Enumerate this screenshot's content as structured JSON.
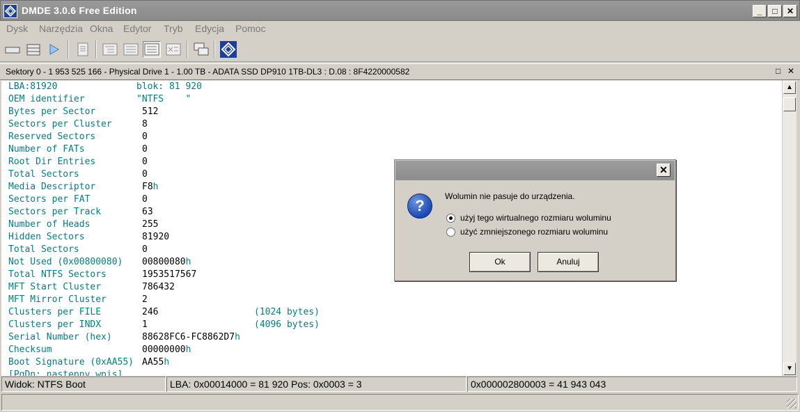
{
  "window": {
    "title": "DMDE 3.0.6 Free Edition"
  },
  "menu": [
    "Dysk",
    "Narzędzia",
    "Okna",
    "Edytor",
    "Tryb",
    "Edycja",
    "Pomoc"
  ],
  "pathbar": {
    "text": "Sektory 0 - 1 953 525 166 - Physical Drive 1 - 1.00 TB - ADATA SSD DP910 1TB-DL3 : D.08 : 8F4220000582"
  },
  "editor": {
    "header_left": "LBA:81920",
    "header_right": "blok: 81 920",
    "rows": [
      {
        "name": "OEM identifier",
        "value": "\"NTFS    \"",
        "suffix": "",
        "note": ""
      },
      {
        "name": "Bytes per Sector",
        "value": "512",
        "suffix": "",
        "note": ""
      },
      {
        "name": "Sectors per Cluster",
        "value": "8",
        "suffix": "",
        "note": ""
      },
      {
        "name": "Reserved Sectors",
        "value": "0",
        "suffix": "",
        "note": ""
      },
      {
        "name": "Number of FATs",
        "value": "0",
        "suffix": "",
        "note": ""
      },
      {
        "name": "Root Dir Entries",
        "value": "0",
        "suffix": "",
        "note": ""
      },
      {
        "name": "Total Sectors",
        "value": "0",
        "suffix": "",
        "note": ""
      },
      {
        "name": "Media Descriptor",
        "value": "F8",
        "suffix": "h",
        "note": ""
      },
      {
        "name": "Sectors per FAT",
        "value": "0",
        "suffix": "",
        "note": ""
      },
      {
        "name": "Sectors per Track",
        "value": "63",
        "suffix": "",
        "note": ""
      },
      {
        "name": "Number of Heads",
        "value": "255",
        "suffix": "",
        "note": ""
      },
      {
        "name": "Hidden Sectors",
        "value": "81920",
        "suffix": "",
        "note": ""
      },
      {
        "name": "Total Sectors",
        "value": "0",
        "suffix": "",
        "note": ""
      },
      {
        "name": "Not Used (0x00800080)",
        "value": "00800080",
        "suffix": "h",
        "note": ""
      },
      {
        "name": "Total NTFS Sectors",
        "value": "1953517567",
        "suffix": "",
        "note": ""
      },
      {
        "name": "MFT Start Cluster",
        "value": "786432",
        "suffix": "",
        "note": ""
      },
      {
        "name": "MFT Mirror Cluster",
        "value": "2",
        "suffix": "",
        "note": ""
      },
      {
        "name": "Clusters per FILE",
        "value": "246",
        "suffix": "",
        "note": "(1024 bytes)"
      },
      {
        "name": "Clusters per INDX",
        "value": "1",
        "suffix": "",
        "note": "(4096 bytes)"
      },
      {
        "name": "Serial Number (hex)",
        "value": "88628FC6-FC8862D7",
        "suffix": "h",
        "note": ""
      },
      {
        "name": "Checksum",
        "value": "00000000",
        "suffix": "h",
        "note": ""
      },
      {
        "name": "Boot Signature (0xAA55)",
        "value": "AA55",
        "suffix": "h",
        "note": ""
      }
    ],
    "partial_row": "[PgDn: następny wpis]"
  },
  "status": {
    "view": "Widok:  NTFS Boot",
    "lba": "LBA: 0x00014000 = 81 920  Pos: 0x0003 = 3",
    "offset": "0x000002800003 = 41 943 043"
  },
  "dialog": {
    "message": "Wolumin nie pasuje do urządzenia.",
    "icon": "question-icon",
    "options": [
      {
        "label": "użyj tego wirtualnego rozmiaru woluminu",
        "selected": true
      },
      {
        "label": "użyć zmniejszonego rozmiaru woluminu",
        "selected": false
      }
    ],
    "ok": "Ok",
    "cancel": "Anuluj"
  }
}
